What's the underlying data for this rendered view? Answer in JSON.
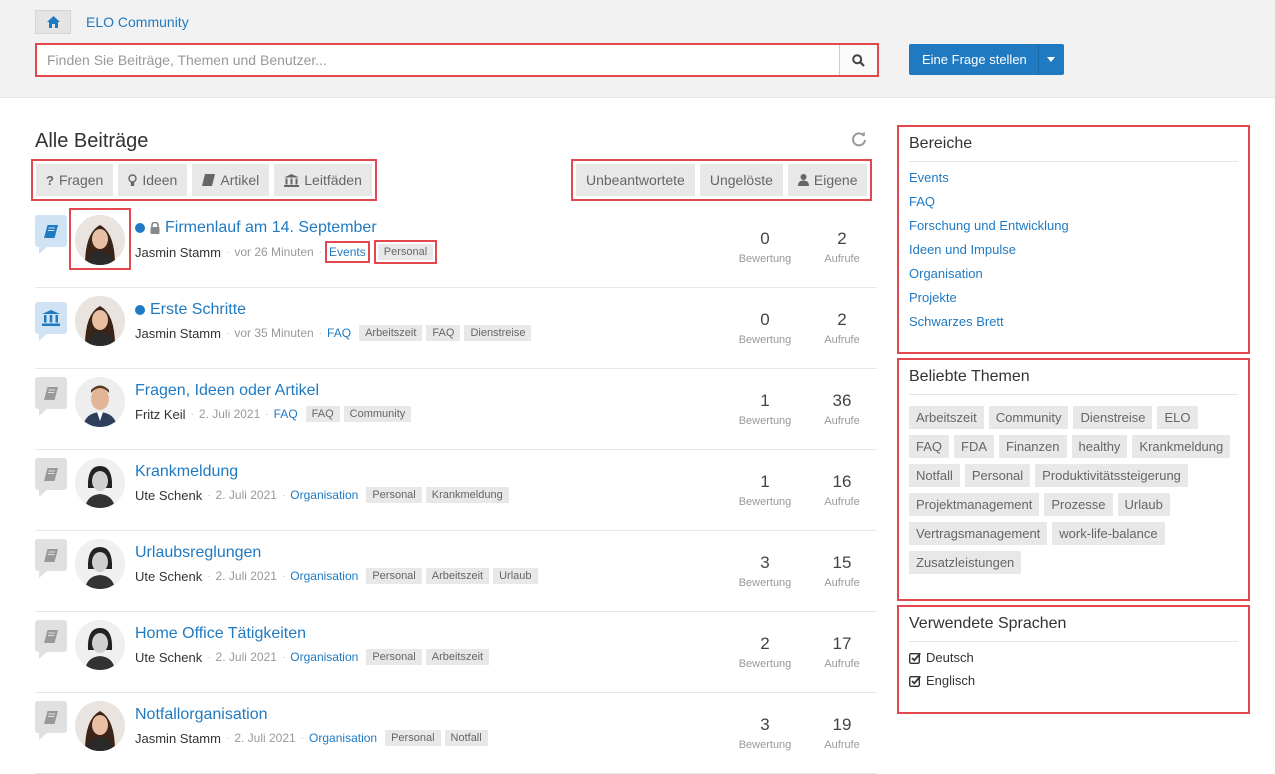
{
  "header": {
    "breadcrumb": "ELO Community",
    "search_placeholder": "Finden Sie Beiträge, Themen und Benutzer...",
    "ask_button": "Eine Frage stellen"
  },
  "main": {
    "title": "Alle Beiträge",
    "filters_left": [
      "Fragen",
      "Ideen",
      "Artikel",
      "Leitfäden"
    ],
    "filters_right": [
      "Unbeantwortete",
      "Ungelöste",
      "Eigene"
    ],
    "stat_labels": {
      "rating": "Bewertung",
      "views": "Aufrufe"
    },
    "posts": [
      {
        "title": "Firmenlauf am 14. September",
        "author": "Jasmin Stamm",
        "time": "vor 26 Minuten",
        "category": "Events",
        "tags": [
          "Personal"
        ],
        "rating": "0",
        "views": "2"
      },
      {
        "title": "Erste Schritte",
        "author": "Jasmin Stamm",
        "time": "vor 35 Minuten",
        "category": "FAQ",
        "tags": [
          "Arbeitszeit",
          "FAQ",
          "Dienstreise"
        ],
        "rating": "0",
        "views": "2"
      },
      {
        "title": "Fragen, Ideen oder Artikel",
        "author": "Fritz Keil",
        "time": "2. Juli 2021",
        "category": "FAQ",
        "tags": [
          "FAQ",
          "Community"
        ],
        "rating": "1",
        "views": "36"
      },
      {
        "title": "Krankmeldung",
        "author": "Ute Schenk",
        "time": "2. Juli 2021",
        "category": "Organisation",
        "tags": [
          "Personal",
          "Krankmeldung"
        ],
        "rating": "1",
        "views": "16"
      },
      {
        "title": "Urlaubsreglungen",
        "author": "Ute Schenk",
        "time": "2. Juli 2021",
        "category": "Organisation",
        "tags": [
          "Personal",
          "Arbeitszeit",
          "Urlaub"
        ],
        "rating": "3",
        "views": "15"
      },
      {
        "title": "Home Office Tätigkeiten",
        "author": "Ute Schenk",
        "time": "2. Juli 2021",
        "category": "Organisation",
        "tags": [
          "Personal",
          "Arbeitszeit"
        ],
        "rating": "2",
        "views": "17"
      },
      {
        "title": "Notfallorganisation",
        "author": "Jasmin Stamm",
        "time": "2. Juli 2021",
        "category": "Organisation",
        "tags": [
          "Personal",
          "Notfall"
        ],
        "rating": "3",
        "views": "19"
      }
    ]
  },
  "sidebar": {
    "areas_title": "Bereiche",
    "areas": [
      "Events",
      "FAQ",
      "Forschung und Entwicklung",
      "Ideen und Impulse",
      "Organisation",
      "Projekte",
      "Schwarzes Brett"
    ],
    "topics_title": "Beliebte Themen",
    "topics": [
      "Arbeitszeit",
      "Community",
      "Dienstreise",
      "ELO",
      "FAQ",
      "FDA",
      "Finanzen",
      "healthy",
      "Krankmeldung",
      "Notfall",
      "Personal",
      "Produktivitätssteigerung",
      "Projektmanagement",
      "Prozesse",
      "Urlaub",
      "Vertragsmanagement",
      "work-life-balance",
      "Zusatzleistungen"
    ],
    "languages_title": "Verwendete Sprachen",
    "languages": [
      "Deutsch",
      "Englisch"
    ]
  },
  "colors": {
    "link": "#1f7ac2",
    "highlight": "#e5474f",
    "button": "#1f7ac2"
  }
}
